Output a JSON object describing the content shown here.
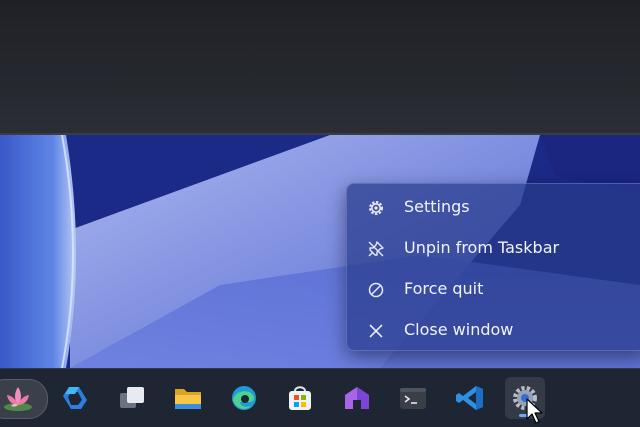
{
  "context_menu": {
    "items": [
      {
        "label": "Settings",
        "icon": "gear-icon"
      },
      {
        "label": "Unpin from Taskbar",
        "icon": "unpin-icon"
      },
      {
        "label": "Force quit",
        "icon": "prohibited-icon"
      },
      {
        "label": "Close window",
        "icon": "close-icon"
      }
    ]
  },
  "taskbar": {
    "items": [
      {
        "icon": "widgets-lotus-icon"
      },
      {
        "icon": "copilot-icon"
      },
      {
        "icon": "task-view-icon"
      },
      {
        "icon": "file-explorer-icon"
      },
      {
        "icon": "edge-browser-icon"
      },
      {
        "icon": "microsoft-store-icon"
      },
      {
        "icon": "home-app-icon"
      },
      {
        "icon": "terminal-icon"
      },
      {
        "icon": "vscode-icon"
      },
      {
        "icon": "settings-gear-icon",
        "state": "active"
      }
    ]
  },
  "colors": {
    "menu_background": "#2c3c8c",
    "taskbar_background": "#1e2533",
    "wallpaper_blue": "#1b2a87",
    "accent": "#6ea8ff"
  }
}
